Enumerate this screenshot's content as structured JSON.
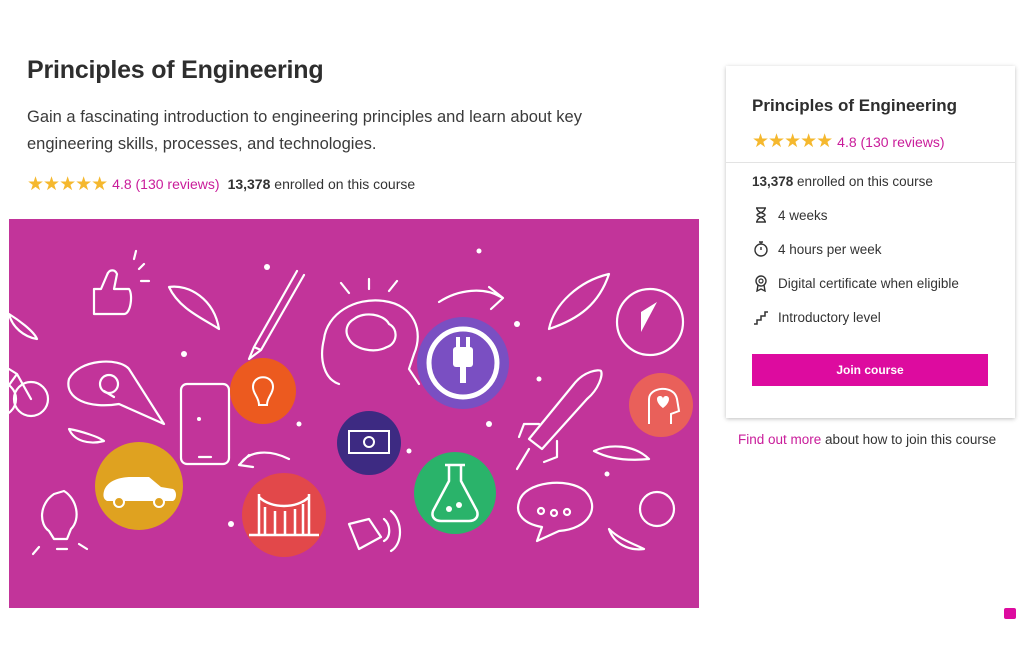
{
  "course": {
    "title": "Principles of Engineering",
    "description": "Gain a fascinating introduction to engineering principles and learn about key engineering skills, processes, and technologies.",
    "stars": "★★★★★",
    "rating_text": "4.8 (130 reviews)",
    "enrolled_count": "13,378",
    "enrolled_suffix": " enrolled on this course"
  },
  "card": {
    "title": "Principles of Engineering",
    "stars": "★★★★★",
    "rating_text": "4.8 (130 reviews)",
    "enrolled_count": "13,378",
    "enrolled_suffix": " enrolled on this course",
    "features": [
      {
        "icon": "hourglass-icon",
        "label": "4 weeks"
      },
      {
        "icon": "stopwatch-icon",
        "label": "4 hours per week"
      },
      {
        "icon": "certificate-icon",
        "label": "Digital certificate when eligible"
      },
      {
        "icon": "stairs-icon",
        "label": "Introductory level"
      }
    ],
    "join_label": "Join course"
  },
  "footer": {
    "link_label": "Find out more",
    "link_suffix": " about how to join this course"
  },
  "colors": {
    "accent": "#dd0b9f",
    "link": "#c91c9a",
    "star": "#f5b82e",
    "hero_bg": "#c2349a"
  }
}
